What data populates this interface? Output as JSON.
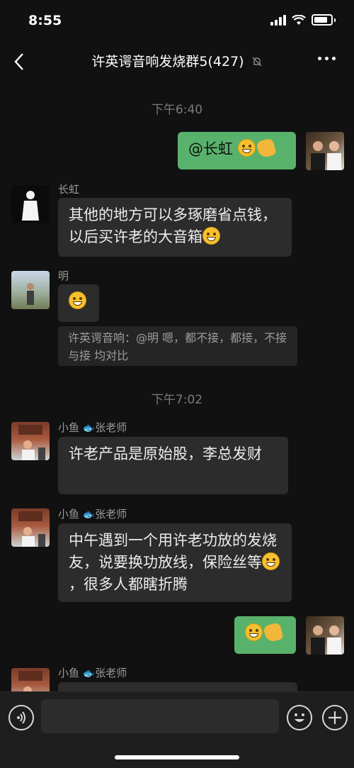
{
  "status": {
    "time": "8:55"
  },
  "header": {
    "back_icon": "chevron-left-icon",
    "title": "许英谔音响发烧群5(427)",
    "mute_icon": "bell-slash-icon",
    "more_icon": "more-dots-icon"
  },
  "timestamps": [
    "下午6:40",
    "下午7:02"
  ],
  "messages": {
    "m1": {
      "text": "@长虹 "
    },
    "m2": {
      "name": "长虹",
      "text": "其他的地方可以多琢磨省点钱，以后买许老的大音箱"
    },
    "m3": {
      "name": "明",
      "quote": "许英谔音响：@明 嗯，都不接，都接，不接与接 均对比"
    },
    "m4": {
      "name": "小鱼 ",
      "name2": "张老师",
      "text": "许老产品是原始股，李总发财"
    },
    "m5": {
      "name": "小鱼 ",
      "name2": "张老师",
      "text1": "中午遇到一个用许老功放的发烧友，说要换功放线，保险丝等",
      "text2": "，很多人都瞎折腾"
    },
    "m7": {
      "name": "小鱼 ",
      "name2": "张老师"
    }
  },
  "input": {
    "voice_icon": "voice-icon",
    "emoji_icon": "emoji-icon",
    "plus_icon": "plus-icon"
  },
  "colors": {
    "background": "#111111",
    "self_bubble": "#59b26b",
    "other_bubble": "#2c2c2c"
  }
}
